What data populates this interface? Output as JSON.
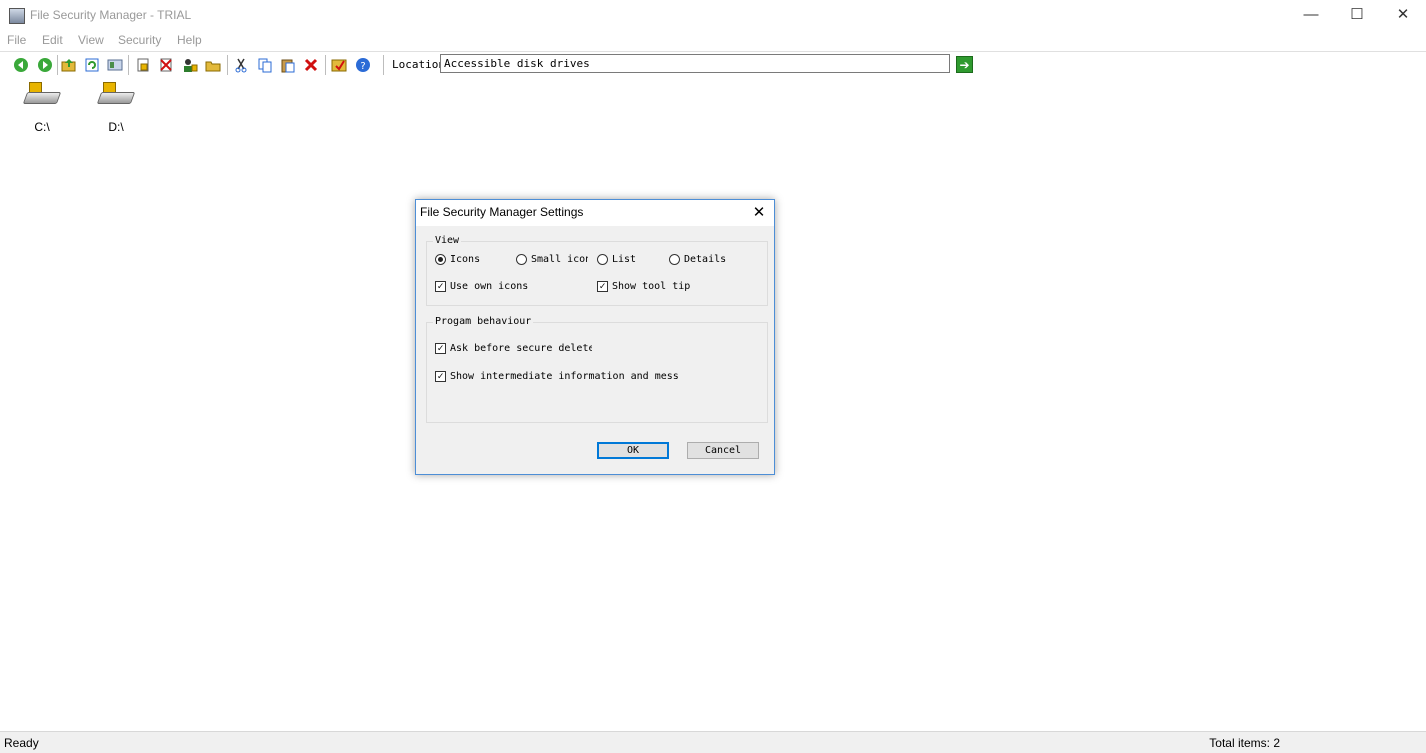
{
  "window": {
    "title": "File Security Manager - TRIAL",
    "minimize": "—",
    "maximize": "☐",
    "close": "✕"
  },
  "menu": [
    "File",
    "Edit",
    "View",
    "Security",
    "Help"
  ],
  "toolbar": {
    "icons": [
      "back-icon",
      "forward-icon",
      "up-folder-icon",
      "refresh-icon",
      "view-icon",
      "lock-file-icon",
      "unlock-file-icon",
      "user-security-icon",
      "open-folder-icon",
      "cut-icon",
      "copy-icon",
      "paste-icon",
      "delete-icon",
      "settings-icon",
      "help-icon"
    ],
    "location_label": "Location",
    "location_value": "Accessible disk drives",
    "go": "➔"
  },
  "drives": [
    {
      "label": "C:\\"
    },
    {
      "label": "D:\\"
    }
  ],
  "status": {
    "left": "Ready",
    "right": "Total items: 2"
  },
  "dialog": {
    "title": "File Security Manager Settings",
    "close": "✕",
    "view_group": {
      "label": "View",
      "radios": [
        {
          "label": "Icons",
          "selected": true
        },
        {
          "label": "Small icons",
          "selected": false
        },
        {
          "label": "List",
          "selected": false
        },
        {
          "label": "Details",
          "selected": false
        }
      ],
      "checks": [
        {
          "label": "Use own icons",
          "checked": true
        },
        {
          "label": "Show tool tips",
          "checked": true
        }
      ]
    },
    "behaviour_group": {
      "label": "Progam behaviour",
      "checks": [
        {
          "label": "Ask before secure delete",
          "checked": true
        },
        {
          "label": "Show intermediate information and messages",
          "checked": true
        }
      ]
    },
    "ok": "OK",
    "cancel": "Cancel"
  }
}
